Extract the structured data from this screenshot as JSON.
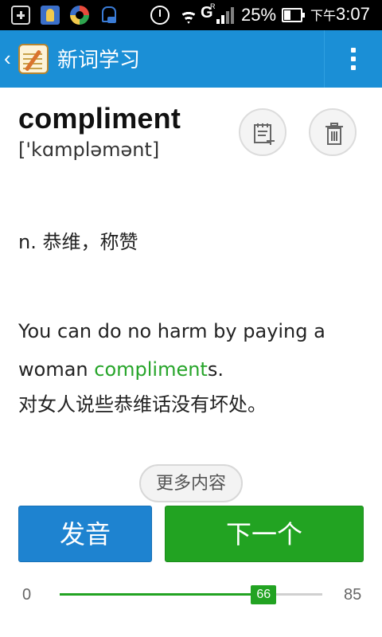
{
  "status_bar": {
    "signal_label": "G",
    "roaming_label": "R",
    "battery": "25%",
    "time_period": "下午",
    "time": "3:07"
  },
  "action_bar": {
    "title": "新词学习"
  },
  "word": {
    "text": "compliment",
    "phonetic": "['kɑmpləmənt]"
  },
  "definition": "n. 恭维，称赞",
  "example": {
    "before": "You can do no harm by paying a woman ",
    "highlight": "compliment",
    "after": "s.",
    "translation": "对女人说些恭维话没有坏处。"
  },
  "more_button": "更多内容",
  "buttons": {
    "pronounce": "发音",
    "next": "下一个"
  },
  "progress": {
    "min": "0",
    "max": "85",
    "current": "66",
    "current_value": 66,
    "max_value": 85
  },
  "colors": {
    "action_bar": "#1b8fd6",
    "pronounce_button": "#1e83d0",
    "next_button": "#22a322",
    "highlight": "#27a52a"
  }
}
